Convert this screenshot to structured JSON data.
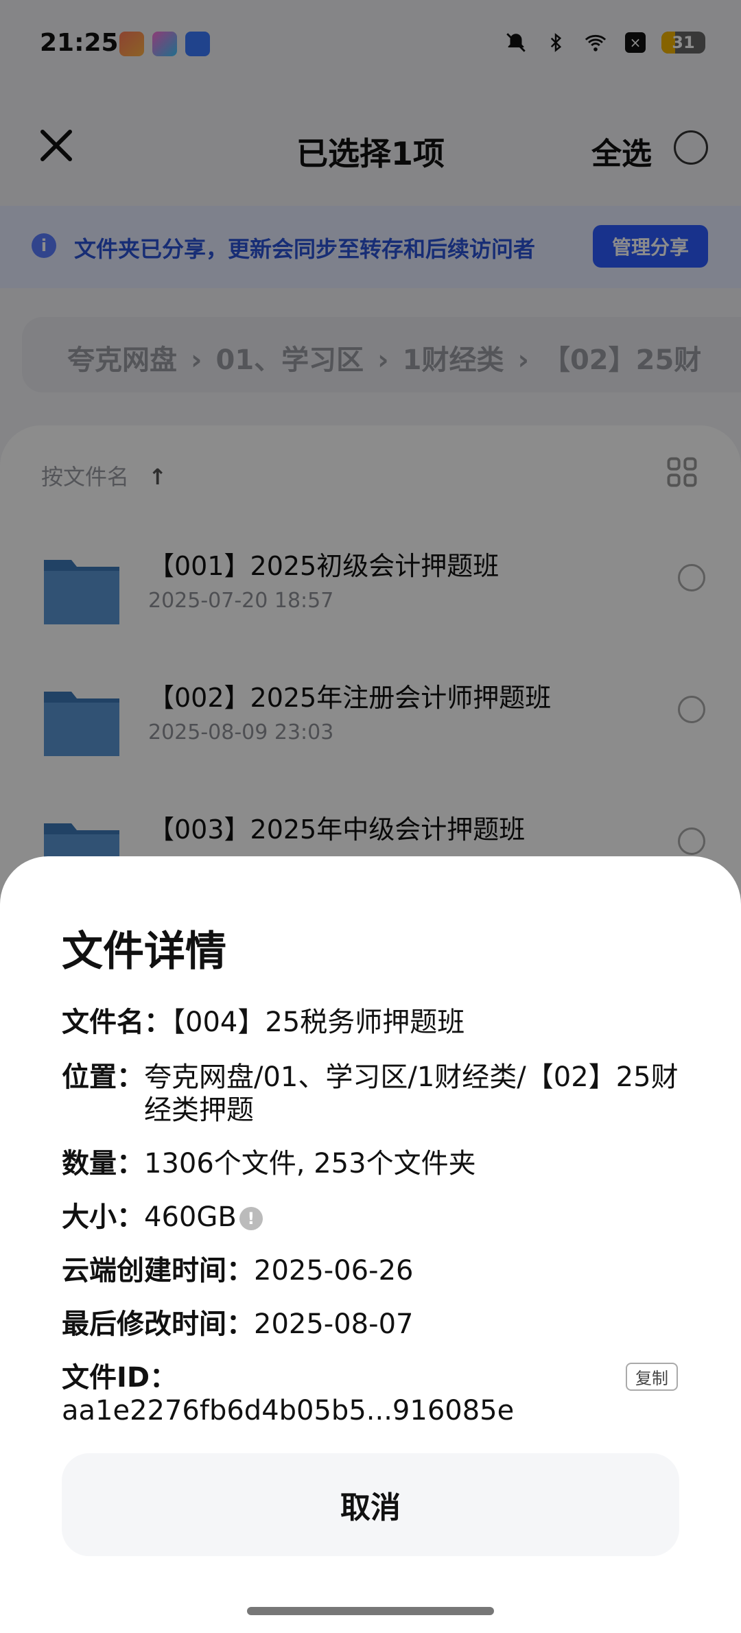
{
  "status_bar": {
    "time": "21:25",
    "battery": "31",
    "icons": [
      "mute-bell-icon",
      "bluetooth-icon",
      "wifi-icon",
      "x-app-icon"
    ]
  },
  "header": {
    "title": "已选择1项",
    "select_all": "全选"
  },
  "notice": {
    "text": "文件夹已分享，更新会同步至转存和后续访问者",
    "button": "管理分享"
  },
  "breadcrumb": [
    "夸克网盘",
    "01、学习区",
    "1财经类",
    "【02】25财"
  ],
  "sort": {
    "label": "按文件名"
  },
  "files": [
    {
      "name": "【001】2025初级会计押题班",
      "date": "2025-07-20 18:57"
    },
    {
      "name": "【002】2025年注册会计师押题班",
      "date": "2025-08-09 23:03"
    },
    {
      "name": "【003】2025年中级会计押题班",
      "date": ""
    }
  ],
  "sheet": {
    "title": "文件详情",
    "name_label": "文件名：",
    "name_value": "【004】25税务师押题班",
    "location_label": "位置：",
    "location_value": "夸克网盘/01、学习区/1财经类/【02】25财经类押题",
    "count_label": "数量：",
    "count_value": "1306个文件, 253个文件夹",
    "size_label": "大小：",
    "size_value": "460GB",
    "created_label": "云端创建时间：",
    "created_value": "2025-06-26",
    "modified_label": "最后修改时间：",
    "modified_value": "2025-08-07",
    "id_label": "文件ID：",
    "id_value": "aa1e2276fb6d4b05b5...916085e",
    "copy_label": "复制",
    "cancel_label": "取消"
  },
  "colors": {
    "accent": "#2c5cff",
    "notice_bg": "#e6ecff",
    "folder": "#4a86c5"
  }
}
